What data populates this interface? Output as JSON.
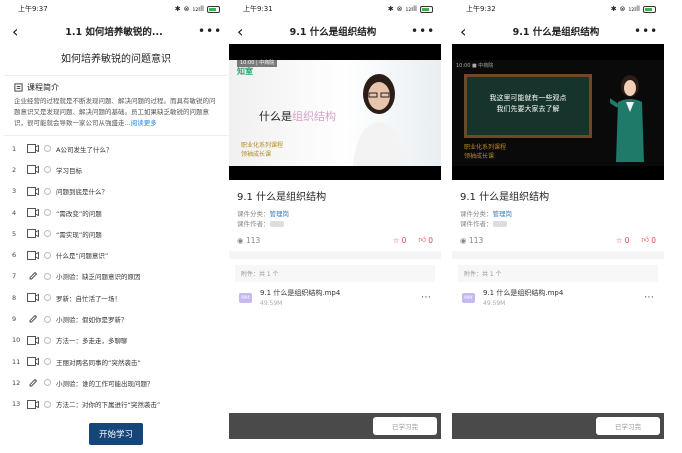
{
  "screen1": {
    "status": {
      "time": "上午9:37",
      "signal": "₁₂ıll",
      "battery": "98"
    },
    "nav": {
      "title": "1.1 如何培养敏锐的...",
      "more": "•••"
    },
    "course_title": "如何培养敏锐的问题意识",
    "intro": {
      "label": "课程简介",
      "text": "企业经营的过程就是不断发现问题、解决问题的过程。而具有敏锐的问题意识又是发现问题、解决问题的基础。员工如果缺乏敏锐的问题意识，很可能就会导致一家公司从強盛走...",
      "more_link": "阅读更多"
    },
    "chapters": [
      {
        "num": "1",
        "type": "video",
        "label": "A公司发生了什么？"
      },
      {
        "num": "2",
        "type": "video",
        "label": "学习目标"
      },
      {
        "num": "3",
        "type": "video",
        "label": "问题到底是什么？"
      },
      {
        "num": "4",
        "type": "video",
        "label": "“需改变”的问题"
      },
      {
        "num": "5",
        "type": "video",
        "label": "“需实现”的问题"
      },
      {
        "num": "6",
        "type": "video",
        "label": "什么是“问题意识”"
      },
      {
        "num": "7",
        "type": "quiz",
        "label": "小测验：缺乏问题意识的原因"
      },
      {
        "num": "8",
        "type": "video",
        "label": "罗新：自忙活了一场！"
      },
      {
        "num": "9",
        "type": "quiz",
        "label": "小测验：假如你是罗新？"
      },
      {
        "num": "10",
        "type": "video",
        "label": "方法一：多走走，多聊聊"
      },
      {
        "num": "11",
        "type": "video",
        "label": "王丽对两名同事的“突然袭击”"
      },
      {
        "num": "12",
        "type": "quiz",
        "label": "小测验：谁的工作可能出现问题？"
      },
      {
        "num": "13",
        "type": "video",
        "label": "方法二：对你的下属进行“突然袭击”"
      }
    ],
    "start_button": "开始学习"
  },
  "screen2": {
    "status": {
      "time": "上午9:31",
      "signal": "₁₂ıll",
      "battery": "98"
    },
    "nav": {
      "title": "9.1 什么是组织结构",
      "more": "•••"
    },
    "video": {
      "caption": "10:00 | 中商院",
      "logo": "知室",
      "title_prefix": "什么是",
      "title_highlight": "组织结构",
      "sub_line1": "职业化系列课程",
      "sub_line2": "领袖成长课"
    },
    "title": "9.1 什么是组织结构",
    "category_label": "课件分类：",
    "category": "管理岗",
    "author_label": "课件作者：",
    "views": "113",
    "likes": "0",
    "thumbs": "0",
    "attachments_label": "附件：共 1 个",
    "file": {
      "name": "9.1 什么是组织结构.mp4",
      "size": "49.59M",
      "icon": "MP4"
    },
    "learned_button": "已学习完"
  },
  "screen3": {
    "status": {
      "time": "上午9:32",
      "signal": "₁₂ıll",
      "battery": "98"
    },
    "nav": {
      "title": "9.1 什么是组织结构",
      "more": "•••"
    },
    "video": {
      "caption": "10:00 ■ 中商院",
      "board_line1": "我这里可能就有一些观点",
      "board_line2": "我们先要大家去了解",
      "sub_line1": "职业化系列课程",
      "sub_line2": "领袖成长课"
    },
    "title": "9.1 什么是组织结构",
    "category_label": "课件分类：",
    "category": "管理岗",
    "author_label": "课件作者：",
    "views": "113",
    "likes": "0",
    "thumbs": "0",
    "attachments_label": "附件：共 1 个",
    "file": {
      "name": "9.1 什么是组织结构.mp4",
      "size": "49.59M",
      "icon": "MP4"
    },
    "learned_button": "已学习完"
  },
  "colors": {
    "accent_blue": "#2a7fd4",
    "primary_button": "#15467a",
    "like_red": "#e5484d",
    "bottom_bar": "#4a4a4a"
  },
  "icons": [
    "back-icon",
    "more-icon",
    "book-icon",
    "video-icon",
    "quiz-pencil-icon",
    "eye-icon",
    "star-icon",
    "thumb-icon",
    "file-icon"
  ]
}
